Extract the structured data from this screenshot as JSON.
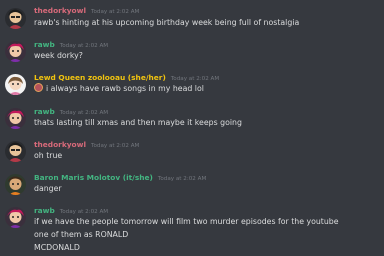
{
  "messages": [
    {
      "author": "thedorkyowl",
      "author_color": "#d86a7a",
      "timestamp": "Today at 2:02 AM",
      "lines": [
        "rawb's hinting at his upcoming birthday week being full of nostalgia"
      ]
    },
    {
      "author": "rawb",
      "author_color": "#43b581",
      "timestamp": "Today at 2:02 AM",
      "lines": [
        "week dorky?"
      ]
    },
    {
      "author": "Lewd Queen zoolooau (she/her)",
      "author_color": "#f1c40f",
      "timestamp": "Today at 2:02 AM",
      "lines": [
        "i always have rawb songs in my head lol"
      ]
    },
    {
      "author": "rawb",
      "author_color": "#43b581",
      "timestamp": "Today at 2:02 AM",
      "lines": [
        "thats lasting till xmas and then maybe it keeps going"
      ]
    },
    {
      "author": "thedorkyowl",
      "author_color": "#d86a7a",
      "timestamp": "Today at 2:02 AM",
      "lines": [
        "oh true"
      ]
    },
    {
      "author": "Baron Maris Molotov (it/she)",
      "author_color": "#43b581",
      "timestamp": "Today at 2:02 AM",
      "lines": [
        "danger"
      ]
    },
    {
      "author": "rawb",
      "author_color": "#43b581",
      "timestamp": "Today at 2:02 AM",
      "lines": [
        "if we have the people tomorrow will film two murder episodes for the youtube",
        "one of them as RONALD",
        "MCDONALD"
      ]
    }
  ]
}
